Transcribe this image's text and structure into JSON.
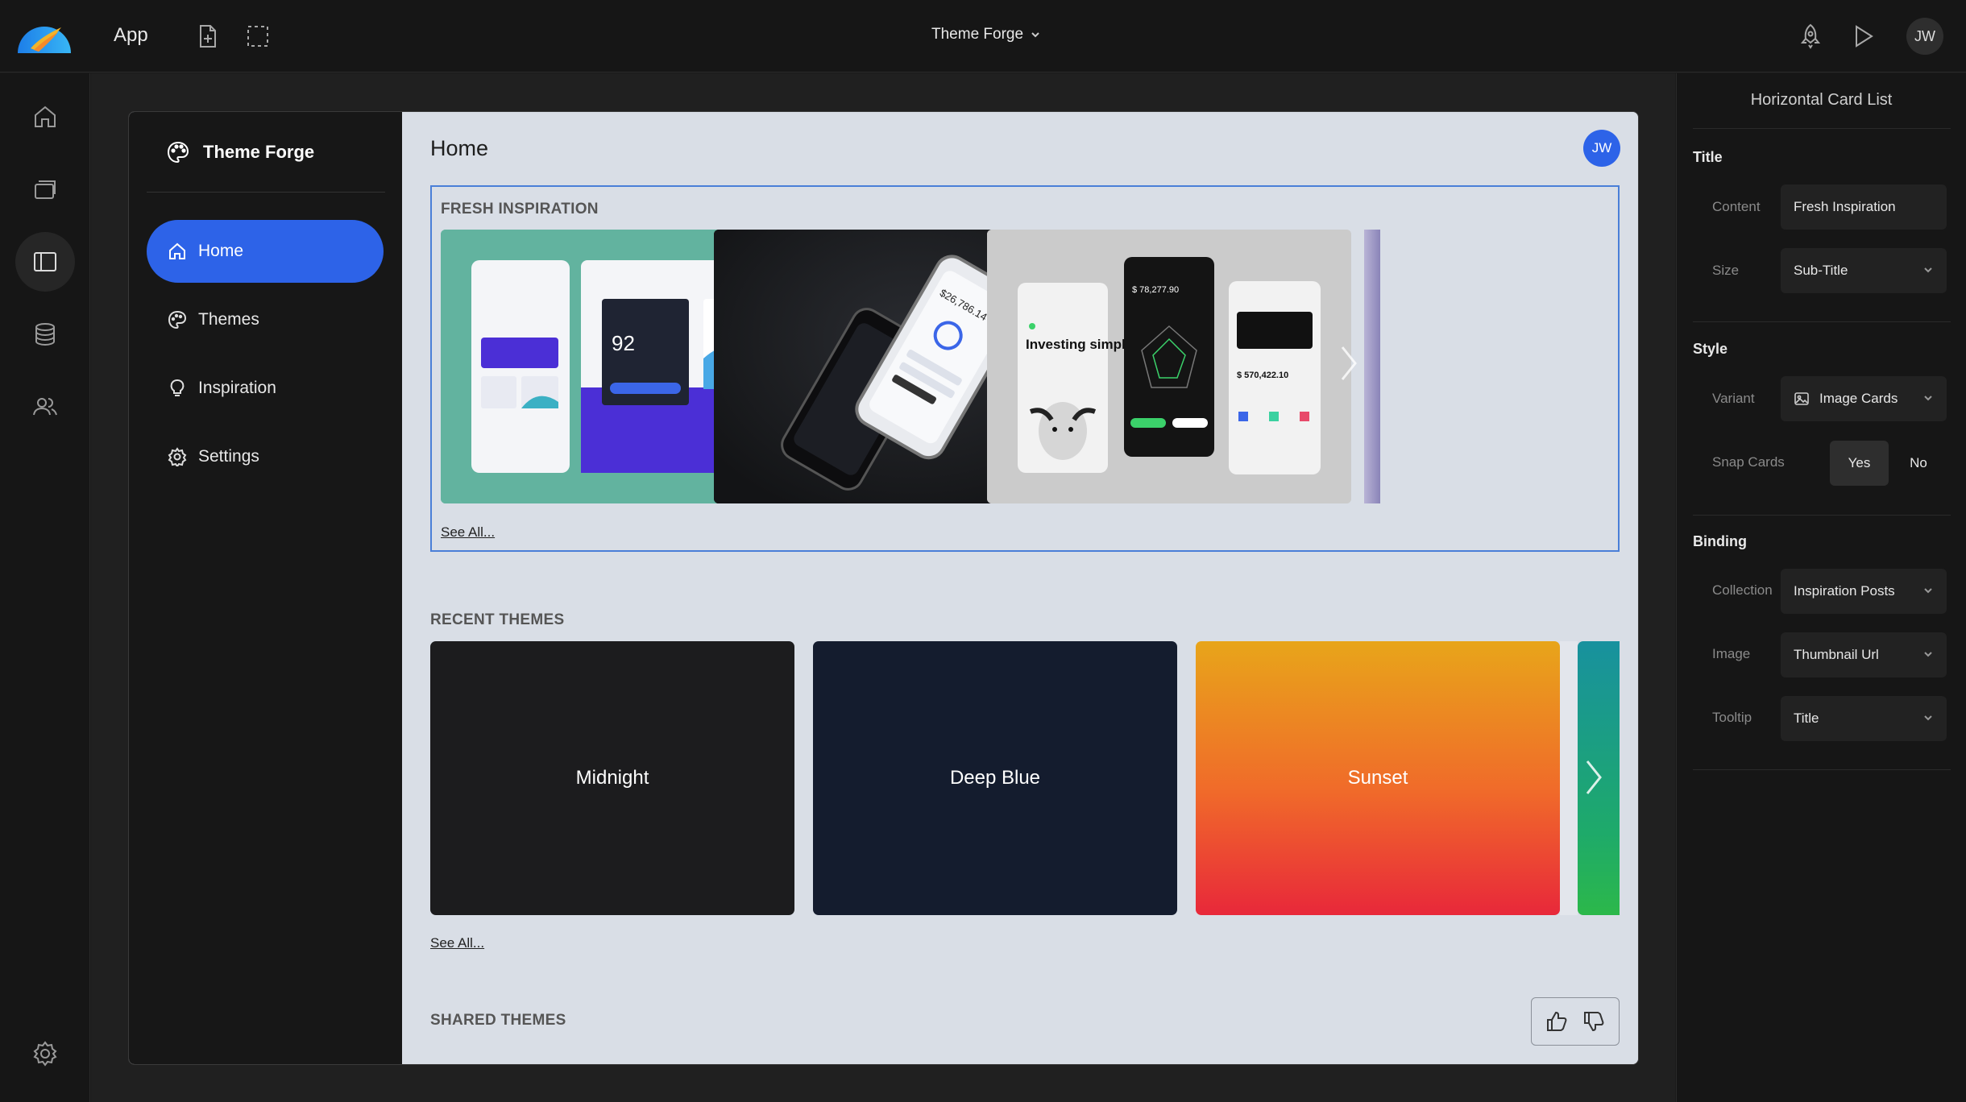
{
  "topbar": {
    "app_label": "App",
    "project_title": "Theme Forge",
    "user_initials": "JW"
  },
  "frame": {
    "brand": "Theme Forge",
    "nav": [
      {
        "label": "Home",
        "icon": "home-icon",
        "active": true
      },
      {
        "label": "Themes",
        "icon": "palette-icon",
        "active": false
      },
      {
        "label": "Inspiration",
        "icon": "lightbulb-icon",
        "active": false
      },
      {
        "label": "Settings",
        "icon": "gear-icon",
        "active": false
      }
    ],
    "page_title": "Home",
    "user_initials": "JW",
    "fresh": {
      "heading": "FRESH INSPIRATION",
      "see_all": "See All..."
    },
    "recent": {
      "heading": "RECENT THEMES",
      "see_all": "See All...",
      "themes": [
        {
          "name": "Midnight",
          "color": "#1b1b1d"
        },
        {
          "name": "Deep Blue",
          "color": "#141c2e"
        },
        {
          "name": "Sunset",
          "color": "#e8a21a"
        }
      ]
    },
    "shared": {
      "heading": "SHARED THEMES"
    }
  },
  "mock": {
    "fin1": "$26,786.14",
    "stocks_value": "$ 78,277.90",
    "total_value": "$ 570,422.10",
    "wellness_score": "92",
    "investing": "Investing simplified"
  },
  "panel": {
    "title": "Horizontal Card List",
    "sections": {
      "title": "Title",
      "style": "Style",
      "binding": "Binding"
    },
    "fields": {
      "content_label": "Content",
      "content_value": "Fresh Inspiration",
      "size_label": "Size",
      "size_value": "Sub-Title",
      "variant_label": "Variant",
      "variant_value": "Image Cards",
      "snap_label": "Snap Cards",
      "snap_yes": "Yes",
      "snap_no": "No",
      "collection_label": "Collection",
      "collection_value": "Inspiration Posts",
      "image_label": "Image",
      "image_value": "Thumbnail Url",
      "tooltip_label": "Tooltip",
      "tooltip_value": "Title"
    }
  },
  "colors": {
    "accent": "#2d63e8",
    "selection": "#4a7fd8"
  }
}
